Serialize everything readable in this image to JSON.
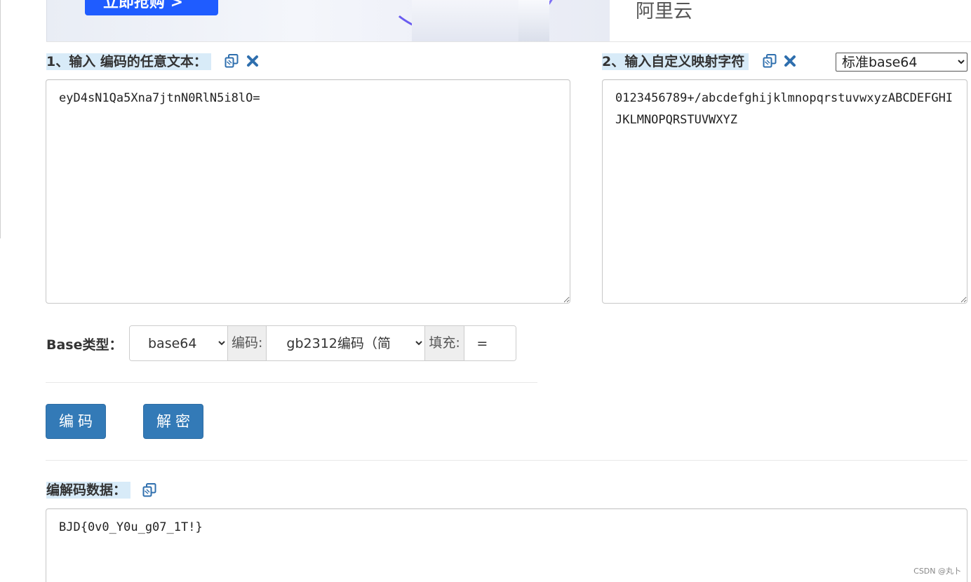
{
  "banner": {
    "button_label": "立即抢购 >",
    "brand": "阿里云"
  },
  "input_section": {
    "heading": "1、输入 编码的任意文本：",
    "value": "eyD4sN1Qa5Xna7jtnN0RlN5i8lO="
  },
  "map_section": {
    "heading": "2、输入自定义映射字符",
    "value": "0123456789+/abcdefghijklmnopqrstuvwxyzABCDEFGHIJKLMNOPQRSTUVWXYZ",
    "preset_selected": "标准base64"
  },
  "options": {
    "base_type_label": "Base类型：",
    "base_type_selected": "base64",
    "encoding_label": "编码:",
    "encoding_selected": "gb2312编码（简",
    "padding_label": "填充:",
    "padding_value": "="
  },
  "actions": {
    "encode_label": "编码",
    "decode_label": "解密"
  },
  "output_section": {
    "heading": "编解码数据：",
    "value": "BJD{0v0_Y0u_g07_1T!}"
  },
  "watermark": "CSDN @丸卜",
  "colors": {
    "accent": "#337ab7",
    "icon": "#2f6fae",
    "heading_bg": "#d8ebf8"
  }
}
